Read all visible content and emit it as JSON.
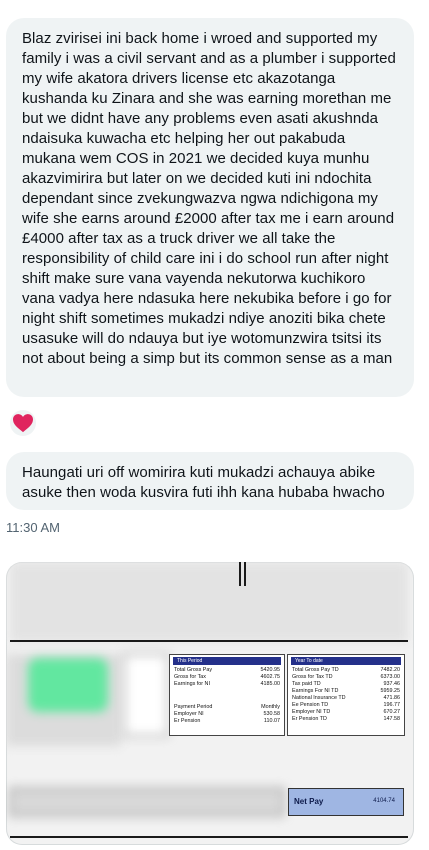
{
  "messages": [
    {
      "text": "Blaz zvirisei ini back home i wroed and supported my family i was a civil servant and as a plumber i supported my wife akatora drivers license etc akazotanga kushanda ku Zinara and she was earning morethan me but we didnt have any problems even asati akushnda ndaisuka kuwacha etc helping her out pakabuda mukana wem COS in 2021 we decided kuya munhu akazvimirira but  later on we decided kuti ini ndochita dependant since zvekungwazva ngwa ndichigona my wife she earns around £2000 after tax me i earn around £4000 after tax as a truck driver we all take the responsibility of child care ini i do school run after night shift make sure vana vayenda nekutorwa kuchikoro vana vadya here ndasuka here nekubika before i go for night shift sometimes mukadzi ndiye anoziti bika chete usasuke will do ndauya but iye wotomunzwira tsitsi its not about being a simp but its common sense as a man"
    },
    {
      "text": "Haungati uri off womirira kuti mukadzi achauya abike asuke then woda kusvira futi ihh kana hubaba hwacho"
    }
  ],
  "reaction": {
    "icon": "heart-icon",
    "color": "#f91880"
  },
  "timestamp": "11:30 AM",
  "payslip": {
    "this_period": {
      "title": "This Period",
      "rows": [
        {
          "label": "Total Gross Pay",
          "value": "5420.95"
        },
        {
          "label": "Gross for Tax",
          "value": "4602.75"
        },
        {
          "label": "Earnings for NI",
          "value": "4185.00"
        },
        {
          "label": "",
          "value": ""
        },
        {
          "label": "",
          "value": ""
        },
        {
          "label": "Payment Period",
          "value": "Monthly"
        },
        {
          "label": "Employer NI",
          "value": "530.58"
        },
        {
          "label": "Er Pension",
          "value": "110.07"
        }
      ]
    },
    "year_to_date": {
      "title": "Year To date",
      "rows": [
        {
          "label": "Total Gross Pay TD",
          "value": "7482.20"
        },
        {
          "label": "Gross for Tax TD",
          "value": "6373.00"
        },
        {
          "label": "Tax paid TD",
          "value": "937.46"
        },
        {
          "label": "Earnings For NI TD",
          "value": "5959.25"
        },
        {
          "label": "National Insurance TD",
          "value": "471.86"
        },
        {
          "label": "Ee Pension TD",
          "value": "196.77"
        },
        {
          "label": "Employer NI TD",
          "value": "670.27"
        },
        {
          "label": "Er Pension TD",
          "value": "147.58"
        }
      ]
    },
    "net_pay": {
      "label": "Net Pay",
      "value": "4104.74"
    }
  }
}
